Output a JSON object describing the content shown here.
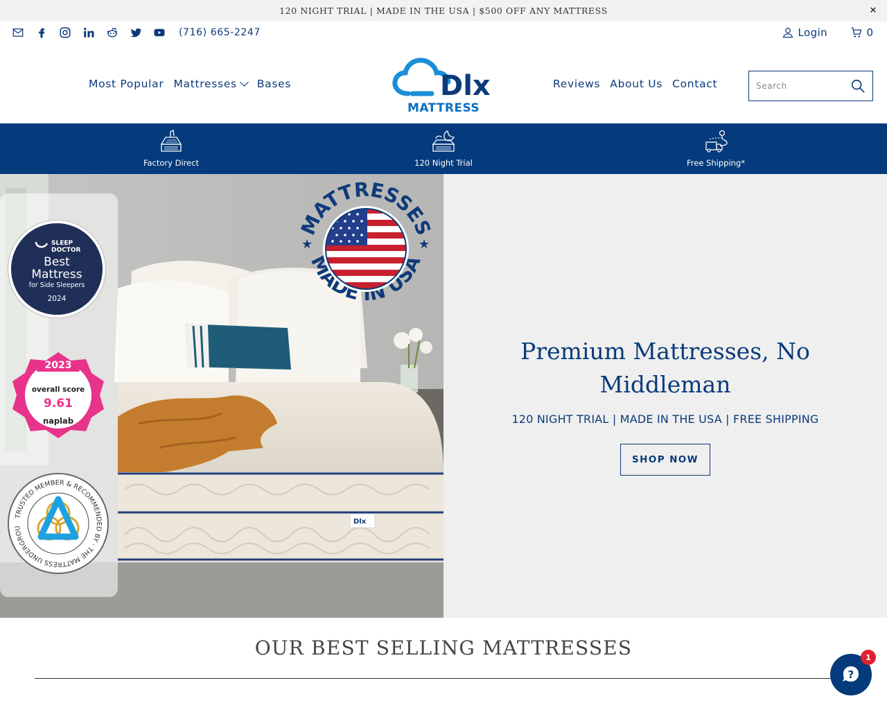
{
  "announcement": {
    "text": "120 NIGHT TRIAL | MADE IN THE USA | $500 OFF ANY MATTRESS",
    "close_label": "✕"
  },
  "header": {
    "social_icons": [
      "email-icon",
      "facebook-icon",
      "instagram-icon",
      "linkedin-icon",
      "reddit-icon",
      "twitter-icon",
      "youtube-icon"
    ],
    "phone": "(716) 665-2247",
    "login_label": "Login",
    "cart_count": "0",
    "logo_text": "Dlx",
    "logo_sub": "MATTRESS",
    "search_placeholder": "Search"
  },
  "nav": {
    "left": [
      "Most Popular",
      "Mattresses",
      "Bases"
    ],
    "right": [
      "Reviews",
      "About Us",
      "Contact"
    ]
  },
  "features": [
    {
      "label": "Factory Direct",
      "icon": "mattress-icon"
    },
    {
      "label": "120 Night Trial",
      "icon": "sleep-moon-icon"
    },
    {
      "label": "Free Shipping*",
      "icon": "delivery-truck-icon"
    }
  ],
  "hero": {
    "title_line1": "Premium Mattresses, No",
    "title_line2": "Middleman",
    "subtitle": "120 NIGHT TRIAL | MADE IN THE USA | FREE SHIPPING",
    "cta_label": "SHOP NOW",
    "badges": {
      "sleep_doctor": {
        "brand1": "SLEEP",
        "brand2": "DOCTOR",
        "line1": "Best",
        "line2": "Mattress",
        "line3": "for Side Sleepers",
        "year": "2024"
      },
      "naplab": {
        "year": "2023",
        "label": "overall score",
        "score": "9.61",
        "brand": "naplab"
      },
      "mattress_underground": {
        "ring_text": "TRUSTED MEMBER & RECOMMENDED BY · THE MATTRESS UNDERGROUND"
      },
      "made_in_usa": {
        "top": "MATTRESSES",
        "bottom": "MADE IN USA"
      },
      "tag_text": "Dlx"
    }
  },
  "best_selling": {
    "title": "OUR BEST SELLING MATTRESSES"
  },
  "chat": {
    "badge_count": "1"
  },
  "colors": {
    "brand_navy": "#053b7c",
    "brand_blue": "#0b6fc4",
    "accent_red": "#e0212f"
  }
}
